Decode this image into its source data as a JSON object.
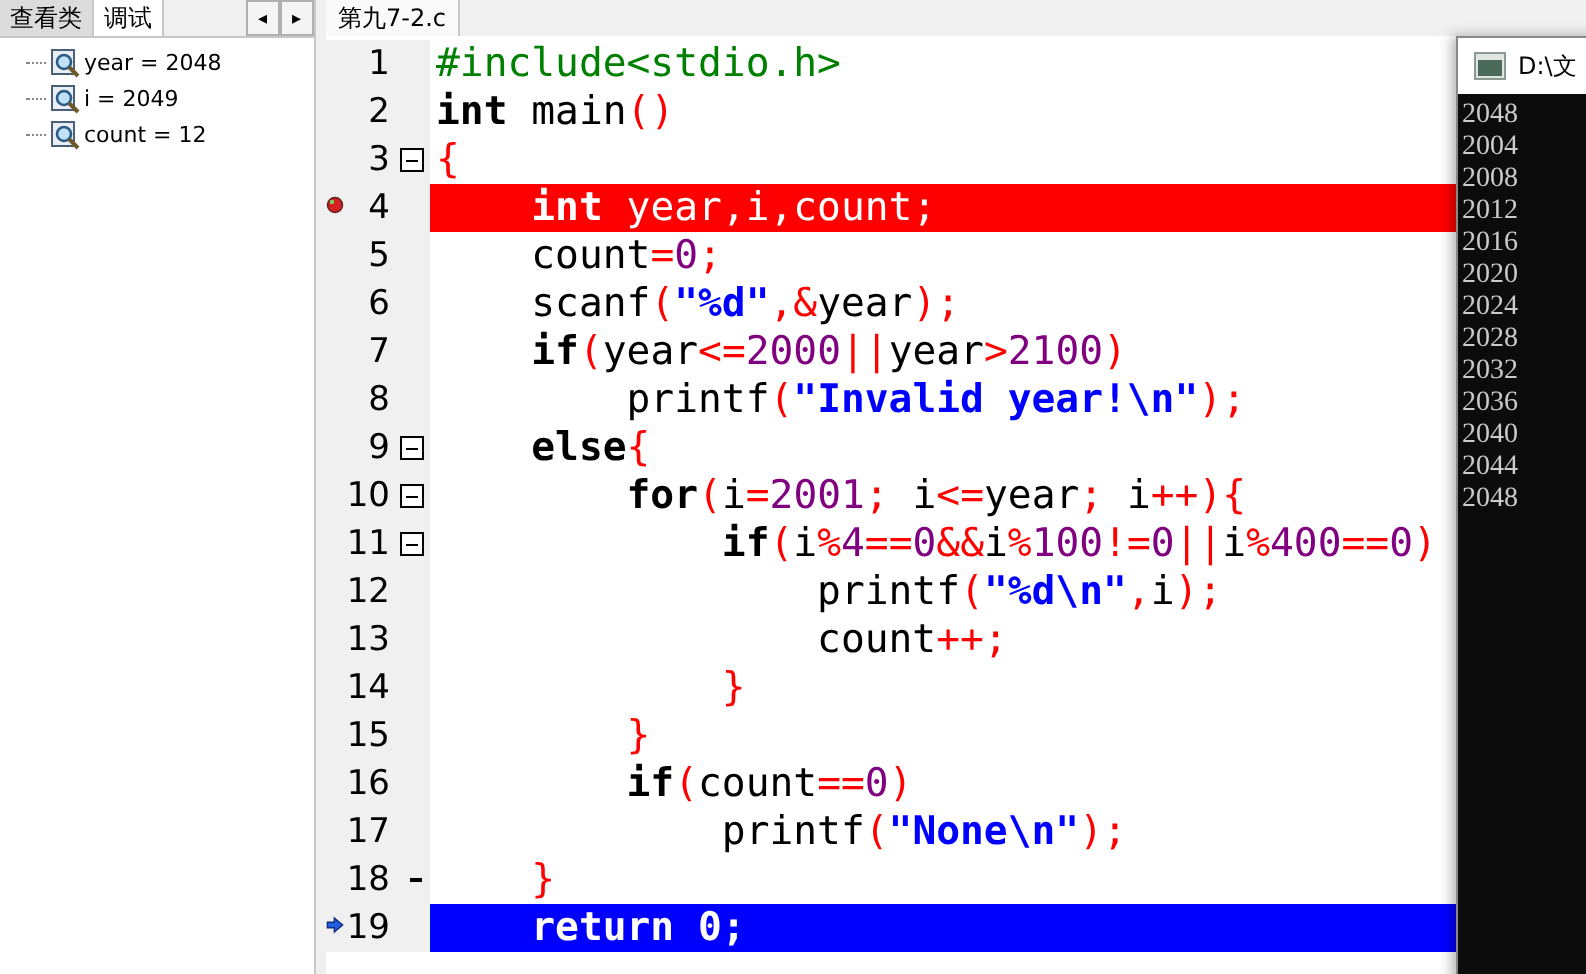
{
  "left_panel": {
    "tabs": [
      {
        "label": "查看类",
        "selected": false
      },
      {
        "label": "调试",
        "selected": true
      }
    ],
    "scroll_buttons": [
      "◂",
      "▸"
    ],
    "watches": [
      {
        "label": "year = 2048"
      },
      {
        "label": "i = 2049"
      },
      {
        "label": "count = 12"
      }
    ]
  },
  "editor": {
    "tabs": [
      {
        "label": "第九7-2.c"
      }
    ],
    "lines": [
      {
        "number": "1",
        "breakpoint": false,
        "current": false,
        "fold_toggle": false,
        "fold_end": false,
        "tokens": [
          {
            "kind": "pp",
            "text": "#include<stdio.h>"
          }
        ]
      },
      {
        "number": "2",
        "breakpoint": false,
        "current": false,
        "fold_toggle": false,
        "fold_end": false,
        "tokens": [
          {
            "kind": "kw",
            "text": "int"
          },
          {
            "kind": "id",
            "text": " main"
          },
          {
            "kind": "op",
            "text": "()"
          }
        ]
      },
      {
        "number": "3",
        "breakpoint": false,
        "current": false,
        "fold_toggle": true,
        "fold_end": false,
        "tokens": [
          {
            "kind": "op",
            "text": "{"
          }
        ]
      },
      {
        "number": "4",
        "breakpoint": true,
        "current": false,
        "fold_toggle": false,
        "fold_end": false,
        "tokens": [
          {
            "kind": "kw",
            "text": "    int"
          },
          {
            "kind": "id",
            "text": " year,i,count;"
          }
        ]
      },
      {
        "number": "5",
        "breakpoint": false,
        "current": false,
        "fold_toggle": false,
        "fold_end": false,
        "tokens": [
          {
            "kind": "id",
            "text": "    count"
          },
          {
            "kind": "op",
            "text": "="
          },
          {
            "kind": "num",
            "text": "0"
          },
          {
            "kind": "op",
            "text": ";"
          }
        ]
      },
      {
        "number": "6",
        "breakpoint": false,
        "current": false,
        "fold_toggle": false,
        "fold_end": false,
        "tokens": [
          {
            "kind": "id",
            "text": "    scanf"
          },
          {
            "kind": "op",
            "text": "("
          },
          {
            "kind": "str",
            "text": "\"%d\""
          },
          {
            "kind": "op",
            "text": ",&"
          },
          {
            "kind": "id",
            "text": "year"
          },
          {
            "kind": "op",
            "text": ");"
          }
        ]
      },
      {
        "number": "7",
        "breakpoint": false,
        "current": false,
        "fold_toggle": false,
        "fold_end": false,
        "tokens": [
          {
            "kind": "kw",
            "text": "    if"
          },
          {
            "kind": "op",
            "text": "("
          },
          {
            "kind": "id",
            "text": "year"
          },
          {
            "kind": "op",
            "text": "<="
          },
          {
            "kind": "num",
            "text": "2000"
          },
          {
            "kind": "op",
            "text": "||"
          },
          {
            "kind": "id",
            "text": "year"
          },
          {
            "kind": "op",
            "text": ">"
          },
          {
            "kind": "num",
            "text": "2100"
          },
          {
            "kind": "op",
            "text": ")"
          }
        ]
      },
      {
        "number": "8",
        "breakpoint": false,
        "current": false,
        "fold_toggle": false,
        "fold_end": false,
        "tokens": [
          {
            "kind": "id",
            "text": "        printf"
          },
          {
            "kind": "op",
            "text": "("
          },
          {
            "kind": "str",
            "text": "\"Invalid year!\\n\""
          },
          {
            "kind": "op",
            "text": ");"
          }
        ]
      },
      {
        "number": "9",
        "breakpoint": false,
        "current": false,
        "fold_toggle": true,
        "fold_end": false,
        "tokens": [
          {
            "kind": "kw",
            "text": "    else"
          },
          {
            "kind": "op",
            "text": "{"
          }
        ]
      },
      {
        "number": "10",
        "breakpoint": false,
        "current": false,
        "fold_toggle": true,
        "fold_end": false,
        "tokens": [
          {
            "kind": "kw",
            "text": "        for"
          },
          {
            "kind": "op",
            "text": "("
          },
          {
            "kind": "id",
            "text": "i"
          },
          {
            "kind": "op",
            "text": "="
          },
          {
            "kind": "num",
            "text": "2001"
          },
          {
            "kind": "op",
            "text": ";"
          },
          {
            "kind": "id",
            "text": " i"
          },
          {
            "kind": "op",
            "text": "<="
          },
          {
            "kind": "id",
            "text": "year"
          },
          {
            "kind": "op",
            "text": ";"
          },
          {
            "kind": "id",
            "text": " i"
          },
          {
            "kind": "op",
            "text": "++){"
          }
        ]
      },
      {
        "number": "11",
        "breakpoint": false,
        "current": false,
        "fold_toggle": true,
        "fold_end": false,
        "tokens": [
          {
            "kind": "kw",
            "text": "            if"
          },
          {
            "kind": "op",
            "text": "("
          },
          {
            "kind": "id",
            "text": "i"
          },
          {
            "kind": "op",
            "text": "%"
          },
          {
            "kind": "num",
            "text": "4"
          },
          {
            "kind": "op",
            "text": "=="
          },
          {
            "kind": "num",
            "text": "0"
          },
          {
            "kind": "op",
            "text": "&&"
          },
          {
            "kind": "id",
            "text": "i"
          },
          {
            "kind": "op",
            "text": "%"
          },
          {
            "kind": "num",
            "text": "100"
          },
          {
            "kind": "op",
            "text": "!="
          },
          {
            "kind": "num",
            "text": "0"
          },
          {
            "kind": "op",
            "text": "||"
          },
          {
            "kind": "id",
            "text": "i"
          },
          {
            "kind": "op",
            "text": "%"
          },
          {
            "kind": "num",
            "text": "400"
          },
          {
            "kind": "op",
            "text": "=="
          },
          {
            "kind": "num",
            "text": "0"
          },
          {
            "kind": "op",
            "text": ")"
          }
        ]
      },
      {
        "number": "12",
        "breakpoint": false,
        "current": false,
        "fold_toggle": false,
        "fold_end": false,
        "tokens": [
          {
            "kind": "id",
            "text": "                printf"
          },
          {
            "kind": "op",
            "text": "("
          },
          {
            "kind": "str",
            "text": "\"%d\\n\""
          },
          {
            "kind": "op",
            "text": ","
          },
          {
            "kind": "id",
            "text": "i"
          },
          {
            "kind": "op",
            "text": ");"
          }
        ]
      },
      {
        "number": "13",
        "breakpoint": false,
        "current": false,
        "fold_toggle": false,
        "fold_end": false,
        "tokens": [
          {
            "kind": "id",
            "text": "                count"
          },
          {
            "kind": "op",
            "text": "++;"
          }
        ]
      },
      {
        "number": "14",
        "breakpoint": false,
        "current": false,
        "fold_toggle": false,
        "fold_end": false,
        "tokens": [
          {
            "kind": "op",
            "text": "            }"
          }
        ]
      },
      {
        "number": "15",
        "breakpoint": false,
        "current": false,
        "fold_toggle": false,
        "fold_end": false,
        "tokens": [
          {
            "kind": "op",
            "text": "        }"
          }
        ]
      },
      {
        "number": "16",
        "breakpoint": false,
        "current": false,
        "fold_toggle": false,
        "fold_end": false,
        "tokens": [
          {
            "kind": "kw",
            "text": "        if"
          },
          {
            "kind": "op",
            "text": "("
          },
          {
            "kind": "id",
            "text": "count"
          },
          {
            "kind": "op",
            "text": "=="
          },
          {
            "kind": "num",
            "text": "0"
          },
          {
            "kind": "op",
            "text": ")"
          }
        ]
      },
      {
        "number": "17",
        "breakpoint": false,
        "current": false,
        "fold_toggle": false,
        "fold_end": false,
        "tokens": [
          {
            "kind": "id",
            "text": "            printf"
          },
          {
            "kind": "op",
            "text": "("
          },
          {
            "kind": "str",
            "text": "\"None\\n\""
          },
          {
            "kind": "op",
            "text": ");"
          }
        ]
      },
      {
        "number": "18",
        "breakpoint": false,
        "current": false,
        "fold_toggle": false,
        "fold_end": true,
        "tokens": [
          {
            "kind": "op",
            "text": "    }"
          }
        ]
      },
      {
        "number": "19",
        "breakpoint": false,
        "current": true,
        "fold_toggle": false,
        "fold_end": false,
        "tokens": [
          {
            "kind": "kw",
            "text": "    return"
          },
          {
            "kind": "id",
            "text": " 0;"
          }
        ]
      }
    ]
  },
  "console": {
    "title": "D:\\文",
    "output": [
      "2048",
      "2004",
      "2008",
      "2012",
      "2016",
      "2020",
      "2024",
      "2028",
      "2032",
      "2036",
      "2040",
      "2044",
      "2048"
    ]
  }
}
